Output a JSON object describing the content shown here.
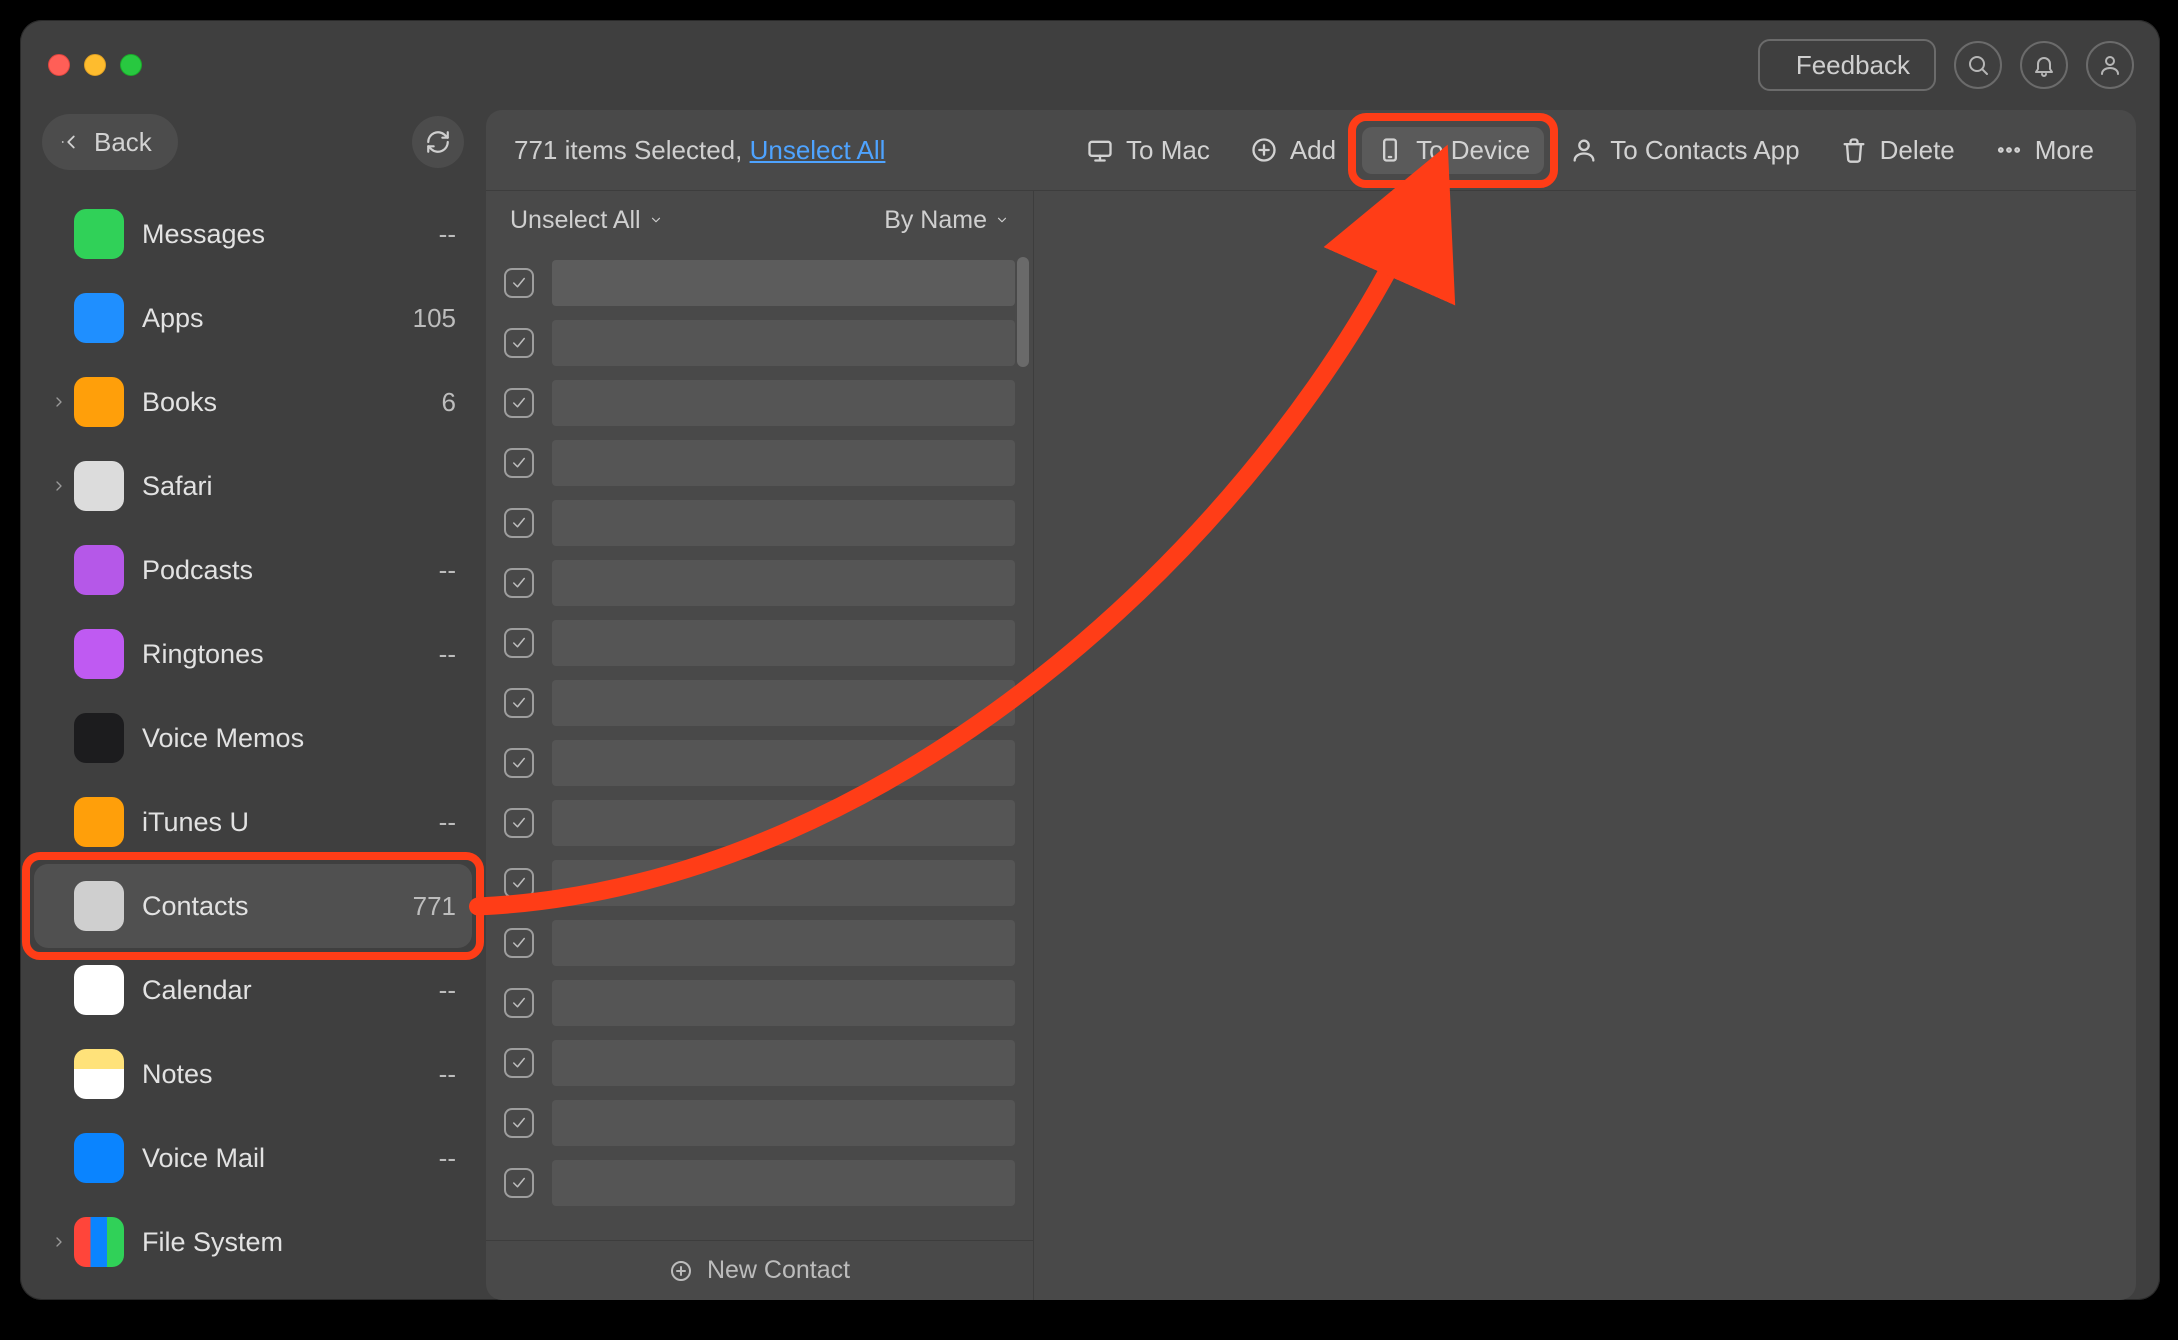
{
  "titlebar": {
    "feedback_label": "Feedback"
  },
  "sidebar": {
    "back_label": "Back",
    "items": [
      {
        "id": "messages",
        "label": "Messages",
        "count": "--",
        "expandable": false,
        "icon": "ic-messages"
      },
      {
        "id": "apps",
        "label": "Apps",
        "count": "105",
        "expandable": false,
        "icon": "ic-apps"
      },
      {
        "id": "books",
        "label": "Books",
        "count": "6",
        "expandable": true,
        "icon": "ic-books"
      },
      {
        "id": "safari",
        "label": "Safari",
        "count": "",
        "expandable": true,
        "icon": "ic-safari"
      },
      {
        "id": "podcasts",
        "label": "Podcasts",
        "count": "--",
        "expandable": false,
        "icon": "ic-podcasts"
      },
      {
        "id": "ringtones",
        "label": "Ringtones",
        "count": "--",
        "expandable": false,
        "icon": "ic-ringtones"
      },
      {
        "id": "voicememos",
        "label": "Voice Memos",
        "count": "",
        "expandable": false,
        "icon": "ic-voicememos"
      },
      {
        "id": "itunesu",
        "label": "iTunes U",
        "count": "--",
        "expandable": false,
        "icon": "ic-itunesu"
      },
      {
        "id": "contacts",
        "label": "Contacts",
        "count": "771",
        "expandable": false,
        "icon": "ic-contacts",
        "active": true
      },
      {
        "id": "calendar",
        "label": "Calendar",
        "count": "--",
        "expandable": false,
        "icon": "ic-calendar"
      },
      {
        "id": "notes",
        "label": "Notes",
        "count": "--",
        "expandable": false,
        "icon": "ic-notes"
      },
      {
        "id": "voicemail",
        "label": "Voice Mail",
        "count": "--",
        "expandable": false,
        "icon": "ic-voicemail"
      },
      {
        "id": "filesystem",
        "label": "File System",
        "count": "",
        "expandable": true,
        "icon": "ic-filesystem"
      }
    ]
  },
  "toolbar": {
    "status_prefix": "771 items Selected, ",
    "unselect_link": "Unselect All",
    "to_mac": "To Mac",
    "add": "Add",
    "to_device": "To Device",
    "to_contacts_app": "To Contacts App",
    "delete": "Delete",
    "more": "More"
  },
  "list": {
    "unselect_all": "Unselect All",
    "sort_by": "By Name",
    "new_contact": "New Contact",
    "rows": 16
  },
  "annotation": {
    "highlight_sidebar_item": "contacts",
    "highlight_toolbar_button": "to_device"
  }
}
